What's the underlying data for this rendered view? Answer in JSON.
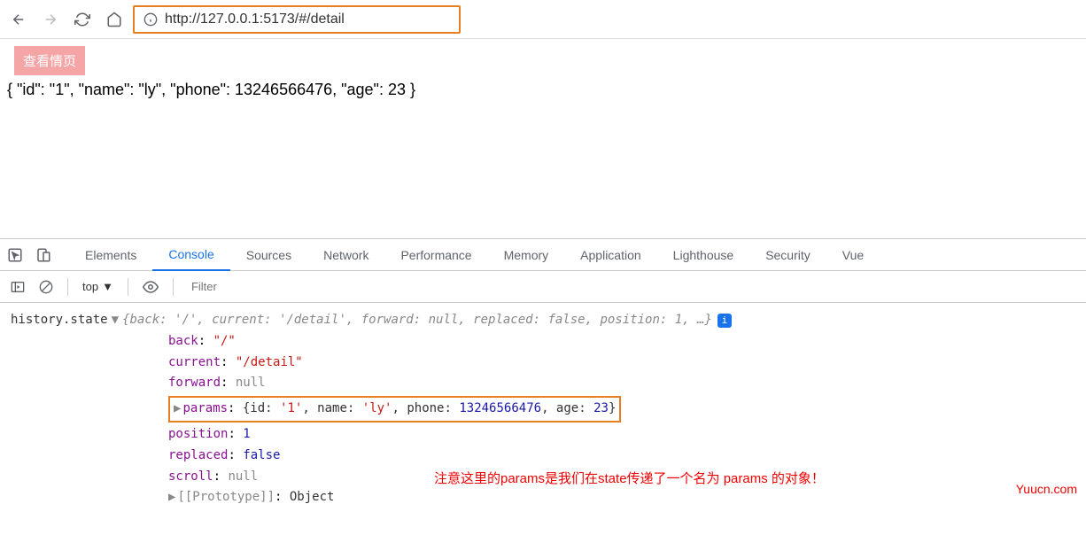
{
  "browser": {
    "url": "http://127.0.0.1:5173/#/detail"
  },
  "page": {
    "button_label": "查看情页",
    "json_display": "{ \"id\": \"1\", \"name\": \"ly\", \"phone\": 13246566476, \"age\": 23 }"
  },
  "devtools": {
    "tabs": [
      "Elements",
      "Console",
      "Sources",
      "Network",
      "Performance",
      "Memory",
      "Application",
      "Lighthouse",
      "Security",
      "Vue"
    ],
    "active_tab": "Console",
    "toolbar": {
      "context": "top",
      "filter_placeholder": "Filter"
    }
  },
  "console": {
    "label": "history.state",
    "preview": "{back: '/', current: '/detail', forward: null, replaced: false, position: 1, …}",
    "info_badge": "i",
    "props": {
      "back": {
        "key": "back",
        "val": "\"/\"",
        "type": "str"
      },
      "current": {
        "key": "current",
        "val": "\"/detail\"",
        "type": "str"
      },
      "forward": {
        "key": "forward",
        "val": "null",
        "type": "null"
      },
      "params": {
        "key": "params",
        "val": "{id: '1', name: 'ly', phone: 13246566476, age: 23}",
        "type": "obj"
      },
      "position": {
        "key": "position",
        "val": "1",
        "type": "num"
      },
      "replaced": {
        "key": "replaced",
        "val": "false",
        "type": "bool"
      },
      "scroll": {
        "key": "scroll",
        "val": "null",
        "type": "null"
      },
      "prototype": {
        "key": "[[Prototype]]",
        "val": "Object",
        "type": "plain"
      }
    }
  },
  "annotation": "注意这里的params是我们在state传递了一个名为 params 的对象！",
  "watermark": "Yuucn.com"
}
